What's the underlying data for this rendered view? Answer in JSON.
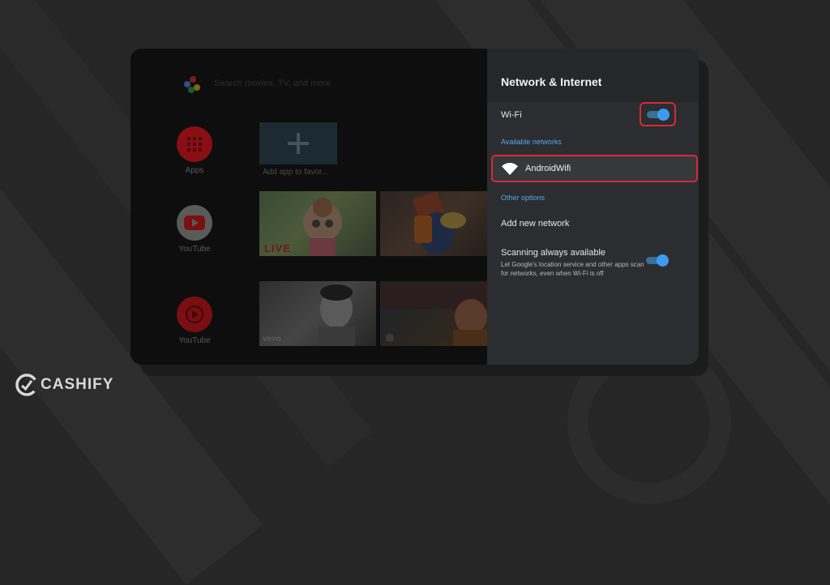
{
  "home": {
    "search_hint": "Search movies, TV, and more",
    "apps_label": "Apps",
    "youtube_label": "YouTube",
    "youtube2_label": "YouTube",
    "add_app_label": "Add app to favor...",
    "live_badge": "LIVE",
    "vevo_badge": "vevo"
  },
  "settings": {
    "title": "Network & Internet",
    "wifi_label": "Wi-Fi",
    "wifi_enabled": true,
    "available_networks_label": "Available networks",
    "network_name": "AndroidWifi",
    "other_options_label": "Other options",
    "add_network_label": "Add new network",
    "scanning_label": "Scanning always available",
    "scanning_description": "Let Google's location service and other apps scan for networks, even when Wi-Fi is off",
    "scanning_enabled": true
  },
  "brand": {
    "name": "CASHIFY"
  },
  "colors": {
    "accent_blue": "#3d9bef",
    "highlight_red": "#d6283a",
    "panel_bg": "#2b2d30",
    "youtube_red": "#b31217"
  }
}
